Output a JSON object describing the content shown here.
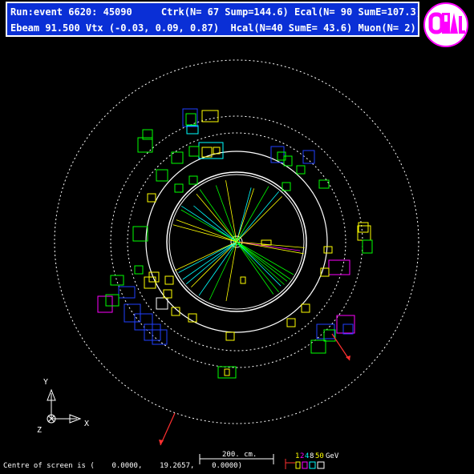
{
  "header": {
    "line1": "Run:event 6620: 45090     Ctrk(N= 67 Sump=144.6) Ecal(N= 90 SumE=107.3)",
    "line2": "Ebeam 91.500 Vtx (-0.03, 0.09, 0.87)  Hcal(N=40 SumE= 43.6) Muon(N= 2)"
  },
  "logo": {
    "text": "OPAL"
  },
  "axes": {
    "y_label": "Y",
    "x_label": "X",
    "z_label": "Z"
  },
  "scale_bar": {
    "label": "200. cm."
  },
  "energy_scale": {
    "values": [
      "1",
      "2",
      "4",
      "8",
      "50"
    ],
    "unit": "GeV",
    "colors": [
      "#ffff00",
      "#ff00ff",
      "#00ffff",
      "#ffffff",
      "#ffff00"
    ]
  },
  "footer": {
    "centre_text": "Centre of screen is (    0.0000,    19.2657,    0.0000)"
  },
  "colors": {
    "background": "#000000",
    "panel": "#0a2fd6",
    "ecal": "#ffff00",
    "hcal": "#00ff00",
    "muon": "#ff3030",
    "tracks": "#00ffff",
    "magenta": "#ff00ff",
    "blue_towers": "#2040ff"
  }
}
